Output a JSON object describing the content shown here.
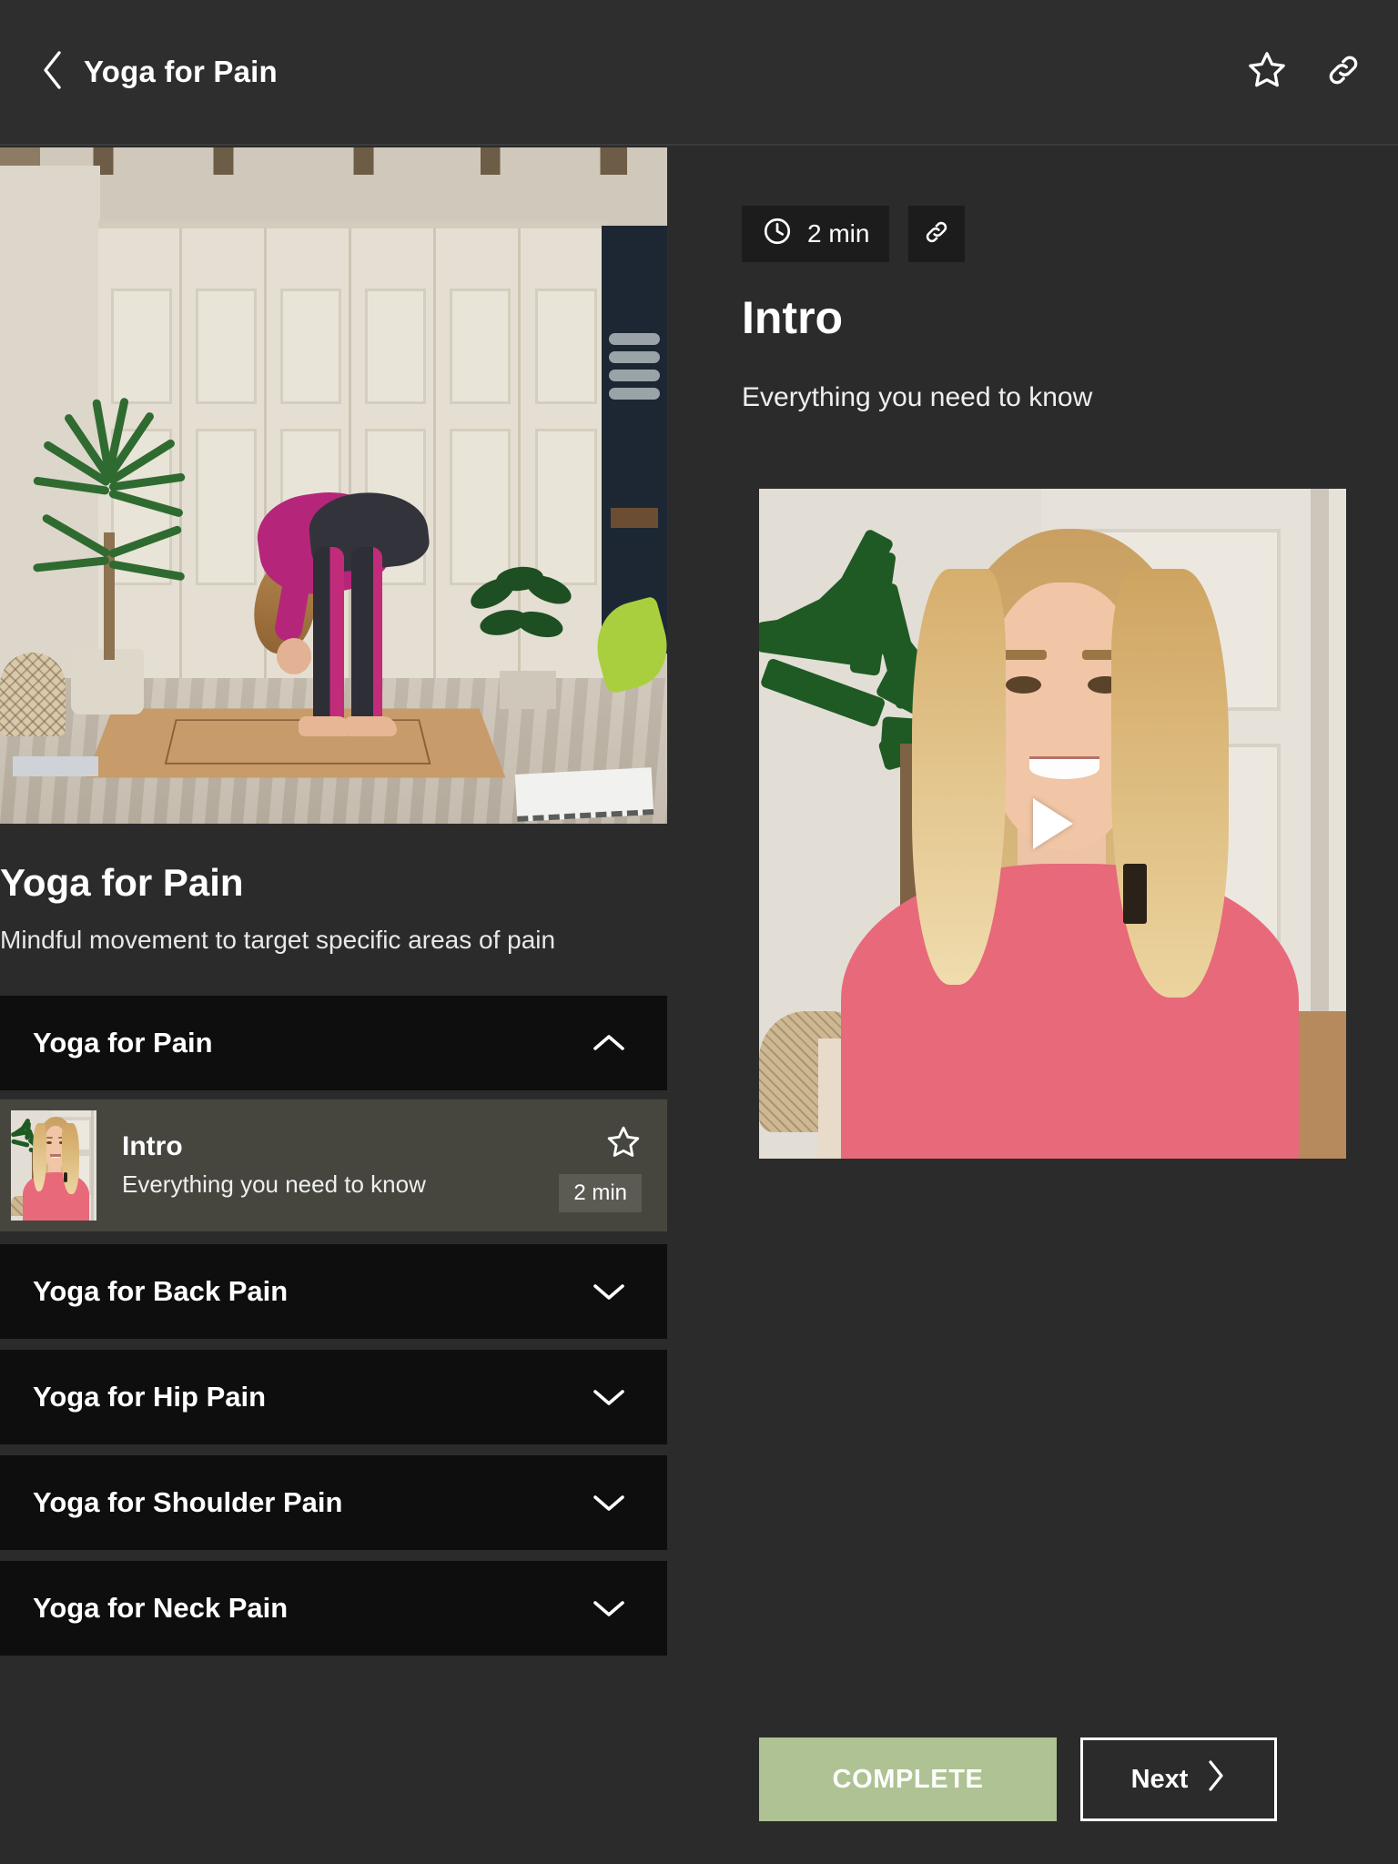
{
  "header": {
    "title": "Yoga for Pain",
    "back_icon": "chevron-left-icon",
    "favorite_icon": "star-outline-icon",
    "share_icon": "link-icon"
  },
  "course": {
    "title": "Yoga for Pain",
    "description": "Mindful movement to target specific areas of pain",
    "hero_image_alt": "Woman in standing forward fold yoga pose in a room with closet doors and plants"
  },
  "sections": [
    {
      "label": "Yoga for Pain",
      "expanded": true,
      "chevron": "chevron-up-icon",
      "lessons": [
        {
          "title": "Intro",
          "subtitle": "Everything you need to know",
          "duration": "2 min",
          "favorite_icon": "star-outline-icon",
          "thumbnail_alt": "Smiling blonde woman in pink top"
        }
      ]
    },
    {
      "label": "Yoga for Back Pain",
      "expanded": false,
      "chevron": "chevron-down-icon",
      "lessons": []
    },
    {
      "label": "Yoga for Hip Pain",
      "expanded": false,
      "chevron": "chevron-down-icon",
      "lessons": []
    },
    {
      "label": "Yoga for Shoulder Pain",
      "expanded": false,
      "chevron": "chevron-down-icon",
      "lessons": []
    },
    {
      "label": "Yoga for Neck Pain",
      "expanded": false,
      "chevron": "chevron-down-icon",
      "lessons": []
    }
  ],
  "lesson_detail": {
    "duration": "2 min",
    "clock_icon": "clock-icon",
    "share_icon": "link-icon",
    "title": "Intro",
    "subtitle": "Everything you need to know",
    "video_alt": "Smiling blonde woman in pink long-sleeve top seated indoors",
    "play_icon": "play-icon"
  },
  "footer": {
    "complete_label": "COMPLETE",
    "next_label": "Next",
    "next_icon": "chevron-right-icon"
  },
  "colors": {
    "page_background": "#2b2b2b",
    "header_background": "#2e2e2e",
    "section_header_background": "#0e0e0e",
    "lesson_row_background": "#46463f",
    "badge_background": "#1c1c1c",
    "complete_button": "#aec293",
    "text_primary": "#ffffff"
  }
}
